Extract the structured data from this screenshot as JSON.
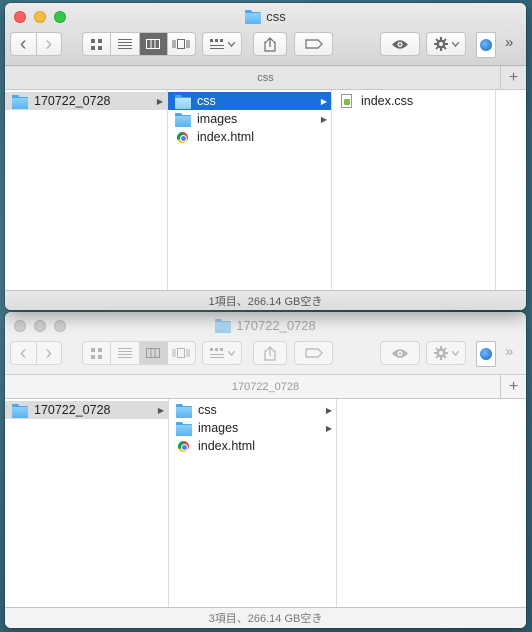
{
  "window1": {
    "title": "css",
    "path_title": "css",
    "columns": [
      [
        {
          "label": "170722_0728",
          "icon": "folder-icon",
          "arrow": true,
          "state": "gray"
        }
      ],
      [
        {
          "label": "css",
          "icon": "folder-icon",
          "arrow": true,
          "state": "blue"
        },
        {
          "label": "images",
          "icon": "folder-icon",
          "arrow": true,
          "state": ""
        },
        {
          "label": "index.html",
          "icon": "chrome-file-icon",
          "arrow": false,
          "state": ""
        }
      ],
      [
        {
          "label": "index.css",
          "icon": "css-file-icon",
          "arrow": false,
          "state": ""
        }
      ]
    ],
    "status": "1項目、266.14 GB空き"
  },
  "window2": {
    "title": "170722_0728",
    "path_title": "170722_0728",
    "columns": [
      [
        {
          "label": "170722_0728",
          "icon": "folder-icon",
          "arrow": true,
          "state": "gray"
        }
      ],
      [
        {
          "label": "css",
          "icon": "folder-icon",
          "arrow": true,
          "state": ""
        },
        {
          "label": "images",
          "icon": "folder-icon",
          "arrow": true,
          "state": ""
        },
        {
          "label": "index.html",
          "icon": "chrome-file-icon",
          "arrow": false,
          "state": ""
        }
      ]
    ],
    "status": "3項目、266.14 GB空き"
  },
  "toolbar": {
    "back_glyph": "‹",
    "forward_glyph": "›",
    "more_glyph": "»",
    "plus_glyph": "+",
    "view_modes": [
      "icon-view",
      "list-view",
      "column-view",
      "cover-flow-view"
    ],
    "selected_view": "column-view"
  },
  "colors": {
    "selection_blue": "#1a6fd8",
    "selection_gray": "#dcdcdc",
    "close": "#fc605c",
    "minimize": "#fdbc40",
    "maximize": "#34c84a"
  }
}
